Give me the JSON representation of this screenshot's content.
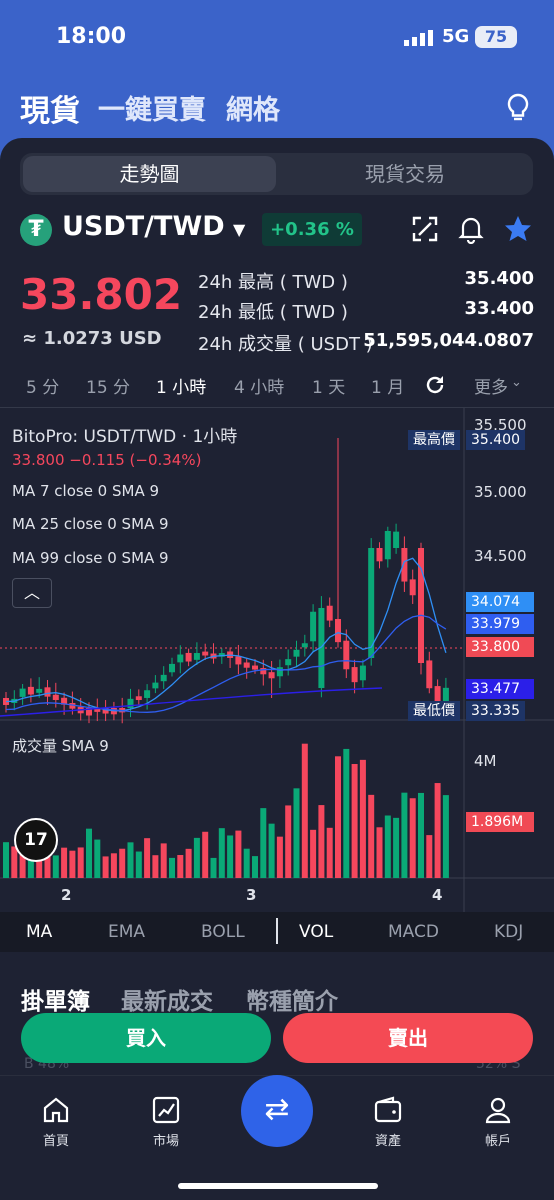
{
  "status": {
    "time": "18:00",
    "network": "5G",
    "battery": "75"
  },
  "header": {
    "tabs": [
      "現貨",
      "一鍵買賣",
      "網格"
    ]
  },
  "segment": {
    "chart": "走勢圖",
    "trade": "現貨交易"
  },
  "pair": {
    "name": "USDT/TWD",
    "change": "+0.36 %"
  },
  "ticker": {
    "price": "33.802",
    "usd": "≈ 1.0273 USD",
    "high_label": "24h 最高 ( TWD )",
    "high": "35.400",
    "low_label": "24h 最低 ( TWD )",
    "low": "33.400",
    "vol_label": "24h 成交量 ( USDT )",
    "vol": "51,595,044.0807"
  },
  "timeframes": [
    "5 分",
    "15 分",
    "1 小時",
    "4 小時",
    "1 天",
    "1 月"
  ],
  "more": "更多",
  "chart": {
    "title": "BitoPro: USDT/TWD · 1小時",
    "ohlc": "33.800  −0.115 (−0.34%)",
    "ma7": "MA 7 close 0 SMA 9",
    "ma25": "MA 25 close 0 SMA 9",
    "ma99": "MA 99 close 0 SMA 9",
    "axis": [
      "35.500",
      "35.000",
      "34.500"
    ],
    "tags": {
      "high_label": "最高價",
      "high": "35.400",
      "low_label": "最低價",
      "low": "33.335",
      "ma7": "34.074",
      "ma25": "33.979",
      "last": "33.800",
      "ma99": "33.477"
    },
    "vol_legend": "成交量 SMA 9",
    "vol_axis": "4M",
    "vol_tag": "1.896M",
    "x_labels": [
      "2",
      "3",
      "4"
    ],
    "tv": "17"
  },
  "indicators": [
    "MA",
    "EMA",
    "BOLL",
    "VOL",
    "MACD",
    "KDJ"
  ],
  "book_tabs": [
    "掛單簿",
    "最新成交",
    "幣種簡介"
  ],
  "actions": {
    "buy": "買入",
    "sell": "賣出",
    "buy_ratio": "B  48%",
    "sell_ratio": "52%  S"
  },
  "nav": [
    "首頁",
    "市場",
    "資產",
    "帳戶"
  ],
  "colors": {
    "up": "#0aa977",
    "down": "#f5475d",
    "accent": "#3b63c9"
  }
}
